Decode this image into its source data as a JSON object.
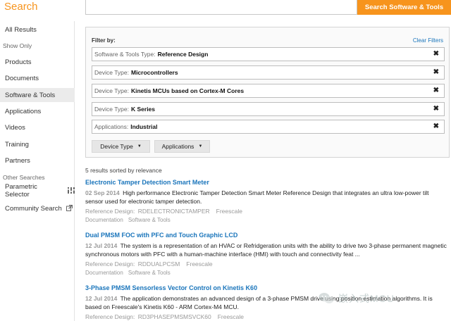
{
  "header": {
    "title": "Search",
    "search_value": "",
    "search_button": "Search Software & Tools"
  },
  "sidebar": {
    "items": [
      {
        "label": "All Results"
      },
      {
        "label": "Products"
      },
      {
        "label": "Documents"
      },
      {
        "label": "Software & Tools"
      },
      {
        "label": "Applications"
      },
      {
        "label": "Videos"
      },
      {
        "label": "Training"
      },
      {
        "label": "Partners"
      },
      {
        "label": "Parametric Selector"
      },
      {
        "label": "Community Search"
      }
    ],
    "section_show_only": "Show Only",
    "section_other": "Other Searches",
    "active_index": 3
  },
  "filters": {
    "heading": "Filter by:",
    "clear": "Clear Filters",
    "rows": [
      {
        "key": "Software & Tools Type:",
        "value": "Reference Design"
      },
      {
        "key": "Device Type:",
        "value": "Microcontrollers"
      },
      {
        "key": "Device Type:",
        "value": "Kinetis MCUs based on Cortex-M Cores"
      },
      {
        "key": "Device Type:",
        "value": "K Series"
      },
      {
        "key": "Applications:",
        "value": "Industrial"
      }
    ],
    "remove_glyph": "✖",
    "dropdowns": [
      {
        "label": "Device Type"
      },
      {
        "label": "Applications"
      }
    ]
  },
  "results": {
    "summary": "5 results sorted by relevance",
    "items": [
      {
        "title": "Electronic Tamper Detection Smart Meter",
        "date": "02 Sep 2014",
        "desc": "High performance Electronic Tamper Detection Smart Meter Reference Design that integrates an ultra low-power tilt sensor used for electronic tamper detection.",
        "type": "Reference Design:",
        "id": "RDELECTRONICTAMPER",
        "vendor": "Freescale",
        "tags": [
          "Documentation",
          "Software & Tools"
        ]
      },
      {
        "title": "Dual PMSM FOC with PFC and Touch Graphic LCD",
        "date": "12 Jul 2014",
        "desc": "The system is a representation of an HVAC or Refridgeration units with the ability to drive two 3-phase permanent magnetic synchronous motors with PFC with a human-machine interface (HMI) with touch and connectivity feat ...",
        "type": "Reference Design:",
        "id": "RDDUALPCSM",
        "vendor": "Freescale",
        "tags": [
          "Documentation",
          "Software & Tools"
        ]
      },
      {
        "title": "3-Phase PMSM Sensorless Vector Control on Kinetis K60",
        "date": "12 Jul 2014",
        "desc": "The application demonstrates an advanced design of a 3-phase PMSM drive using position estimation algorithms. It is based on Freescale's Kinetis K60 - ARM Cortex-M4 MCU.",
        "type": "Reference Design:",
        "id": "RD3PHASEPMSMSVCK60",
        "vendor": "Freescale",
        "tags": []
      }
    ]
  },
  "watermark": {
    "text": "嵌入式MCU"
  },
  "colors": {
    "accent": "#f7941d",
    "link": "#1a75bb"
  }
}
